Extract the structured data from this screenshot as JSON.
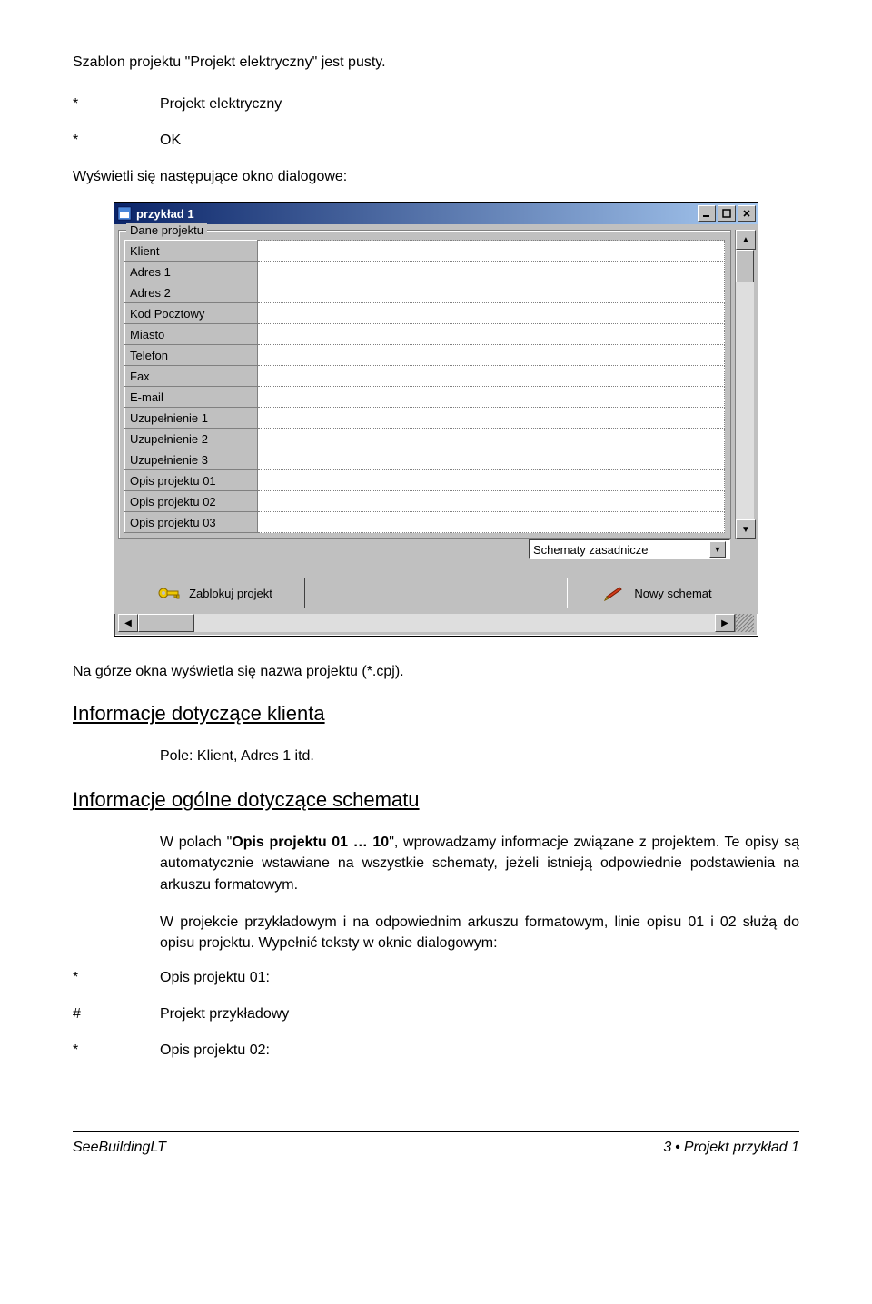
{
  "intro": "Szablon projektu \"Projekt elektryczny\" jest pusty.",
  "bullets_top": [
    {
      "marker": "*",
      "text": "Projekt elektryczny"
    },
    {
      "marker": "*",
      "text": "OK"
    }
  ],
  "dialog_intro": "Wyświetli się następujące okno dialogowe:",
  "dialog": {
    "title": "przykład 1",
    "group_label": "Dane projektu",
    "rows": [
      {
        "label": "Klient",
        "value": ""
      },
      {
        "label": "Adres 1",
        "value": ""
      },
      {
        "label": "Adres 2",
        "value": ""
      },
      {
        "label": "Kod Pocztowy",
        "value": ""
      },
      {
        "label": "Miasto",
        "value": ""
      },
      {
        "label": "Telefon",
        "value": ""
      },
      {
        "label": "Fax",
        "value": ""
      },
      {
        "label": "E-mail",
        "value": ""
      },
      {
        "label": "Uzupełnienie 1",
        "value": ""
      },
      {
        "label": "Uzupełnienie 2",
        "value": ""
      },
      {
        "label": "Uzupełnienie 3",
        "value": ""
      },
      {
        "label": "Opis projektu 01",
        "value": ""
      },
      {
        "label": "Opis projektu 02",
        "value": ""
      },
      {
        "label": "Opis projektu 03",
        "value": ""
      }
    ],
    "combo_value": "Schematy zasadnicze",
    "lock_button": "Zablokuj projekt",
    "new_button": "Nowy schemat"
  },
  "caption_below": "Na górze okna wyświetla się nazwa projektu (*.cpj).",
  "section1": {
    "heading": "Informacje dotyczące klienta",
    "para": "Pole: Klient, Adres 1 itd."
  },
  "section2": {
    "heading": "Informacje ogólne dotyczące schematu",
    "para1_prefix": "W polach \"",
    "para1_bold": "Opis projektu 01 … 10",
    "para1_suffix": "\", wprowadzamy informacje związane z projektem. Te opisy są automatycznie wstawiane na wszystkie schematy, jeżeli istnieją odpowiednie podstawienia na arkuszu formatowym.",
    "para2": "W projekcie przykładowym i na odpowiednim arkuszu formatowym, linie opisu 01 i 02 służą do opisu projektu. Wypełnić teksty w oknie dialogowym:"
  },
  "bullets_bottom": [
    {
      "marker": "*",
      "text": "Opis projektu 01:"
    },
    {
      "marker": "#",
      "text": "Projekt przykładowy"
    },
    {
      "marker": "*",
      "text": "Opis projektu 02:"
    }
  ],
  "footer": {
    "left": "SeeBuildingLT",
    "page": "3",
    "right": "Projekt przykład 1"
  }
}
